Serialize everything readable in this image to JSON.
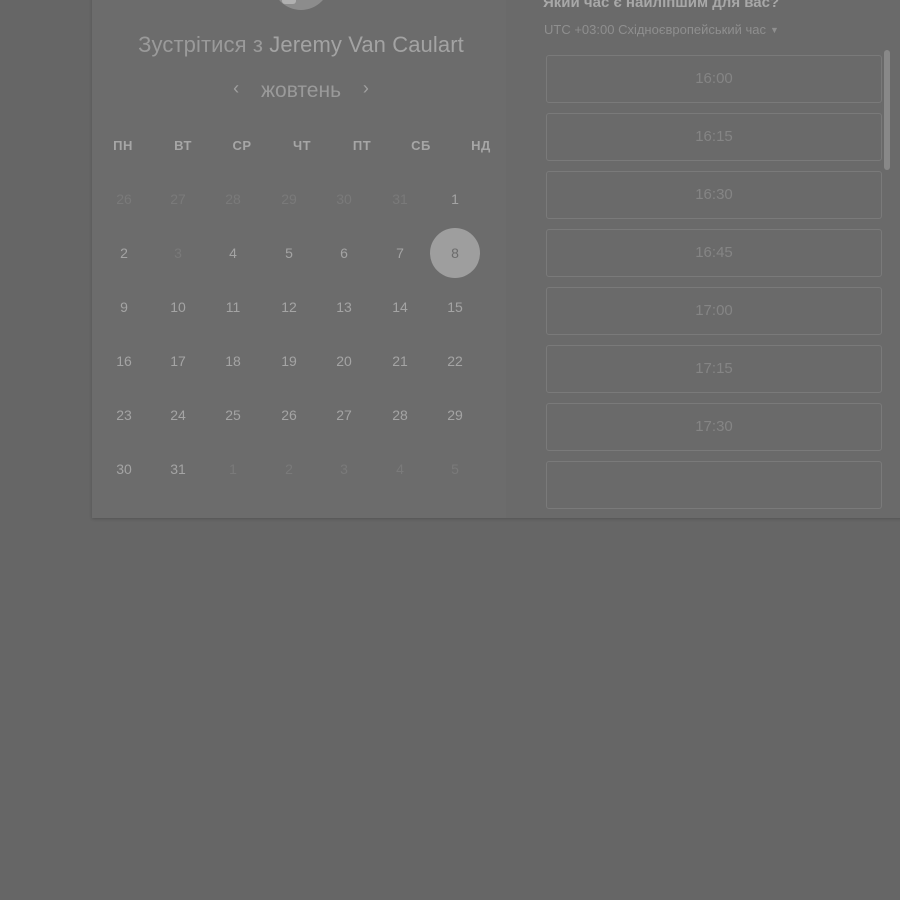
{
  "meeting": {
    "title_prefix": "Зустрітися з",
    "host_name": "Jeremy Van Caulart"
  },
  "calendar": {
    "month": "жовтень",
    "prev_icon": "chevron-left-icon",
    "next_icon": "chevron-right-icon",
    "weekdays": [
      "ПН",
      "ВТ",
      "СР",
      "ЧТ",
      "ПТ",
      "СБ",
      "НД"
    ],
    "weeks": [
      [
        "26",
        "27",
        "28",
        "29",
        "30",
        "31",
        "1"
      ],
      [
        "2",
        "3",
        "4",
        "5",
        "6",
        "7",
        "8"
      ],
      [
        "9",
        "10",
        "11",
        "12",
        "13",
        "14",
        "15"
      ],
      [
        "16",
        "17",
        "18",
        "19",
        "20",
        "21",
        "22"
      ],
      [
        "23",
        "24",
        "25",
        "26",
        "27",
        "28",
        "29"
      ],
      [
        "30",
        "31",
        "1",
        "2",
        "3",
        "4",
        "5"
      ]
    ],
    "selected_day": "8"
  },
  "schedule": {
    "question": "Який час є найліпшим для вас?",
    "timezone": "UTC +03:00 Східноєвропейський час",
    "timezone_icon": "caret-down-icon",
    "slots": [
      "16:00",
      "16:15",
      "16:30",
      "16:45",
      "17:00",
      "17:15",
      "17:30",
      ""
    ]
  },
  "colors": {
    "overlay": "#666666",
    "selected_day_bg": "#9e9e9e"
  }
}
